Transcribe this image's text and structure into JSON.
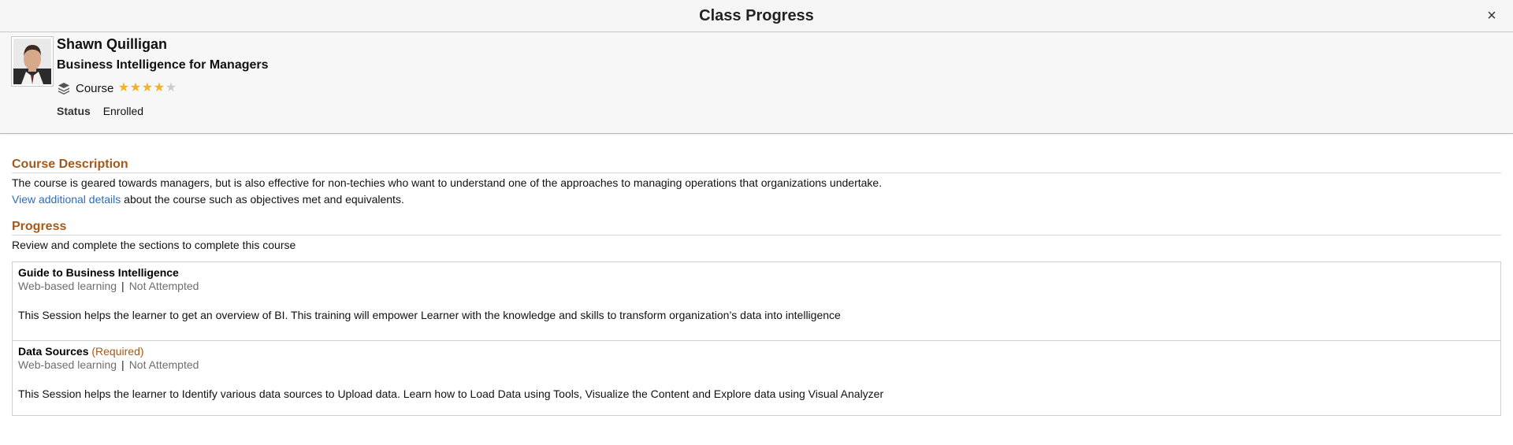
{
  "dialog": {
    "title": "Class Progress",
    "close_label": "×"
  },
  "learner": {
    "name": "Shawn Quilligan",
    "course_title": "Business Intelligence for Managers",
    "type_icon": "stack-icon",
    "type_label": "Course",
    "rating": {
      "value": 4,
      "max": 5
    },
    "status_label": "Status",
    "status_value": "Enrolled"
  },
  "description": {
    "heading": "Course Description",
    "text": "The course is geared towards managers, but is also effective for non-techies who want to understand one of the approaches to managing operations that organizations undertake.",
    "link_text": "View additional details",
    "link_suffix": " about the course such as objectives met and equivalents."
  },
  "progress": {
    "heading": "Progress",
    "intro": "Review and complete the sections to complete this course",
    "sessions": [
      {
        "title": "Guide to Business Intelligence",
        "required": "",
        "method": "Web-based learning",
        "separator": "|",
        "status": "Not Attempted",
        "description": "This Session helps the learner to get an overview of BI. This training will empower Learner with the knowledge and skills to transform organization’s data into intelligence"
      },
      {
        "title": "Data Sources",
        "required": "(Required)",
        "method": "Web-based learning",
        "separator": "|",
        "status": "Not Attempted",
        "description": "This Session helps the learner to Identify  various data sources to Upload data. Learn how to Load Data using Tools, Visualize the Content and Explore data using Visual Analyzer"
      }
    ]
  },
  "colors": {
    "accent": "#a15a1c",
    "link": "#2e6bb7",
    "star_on": "#f0b322",
    "star_off": "#c8ccd0"
  }
}
